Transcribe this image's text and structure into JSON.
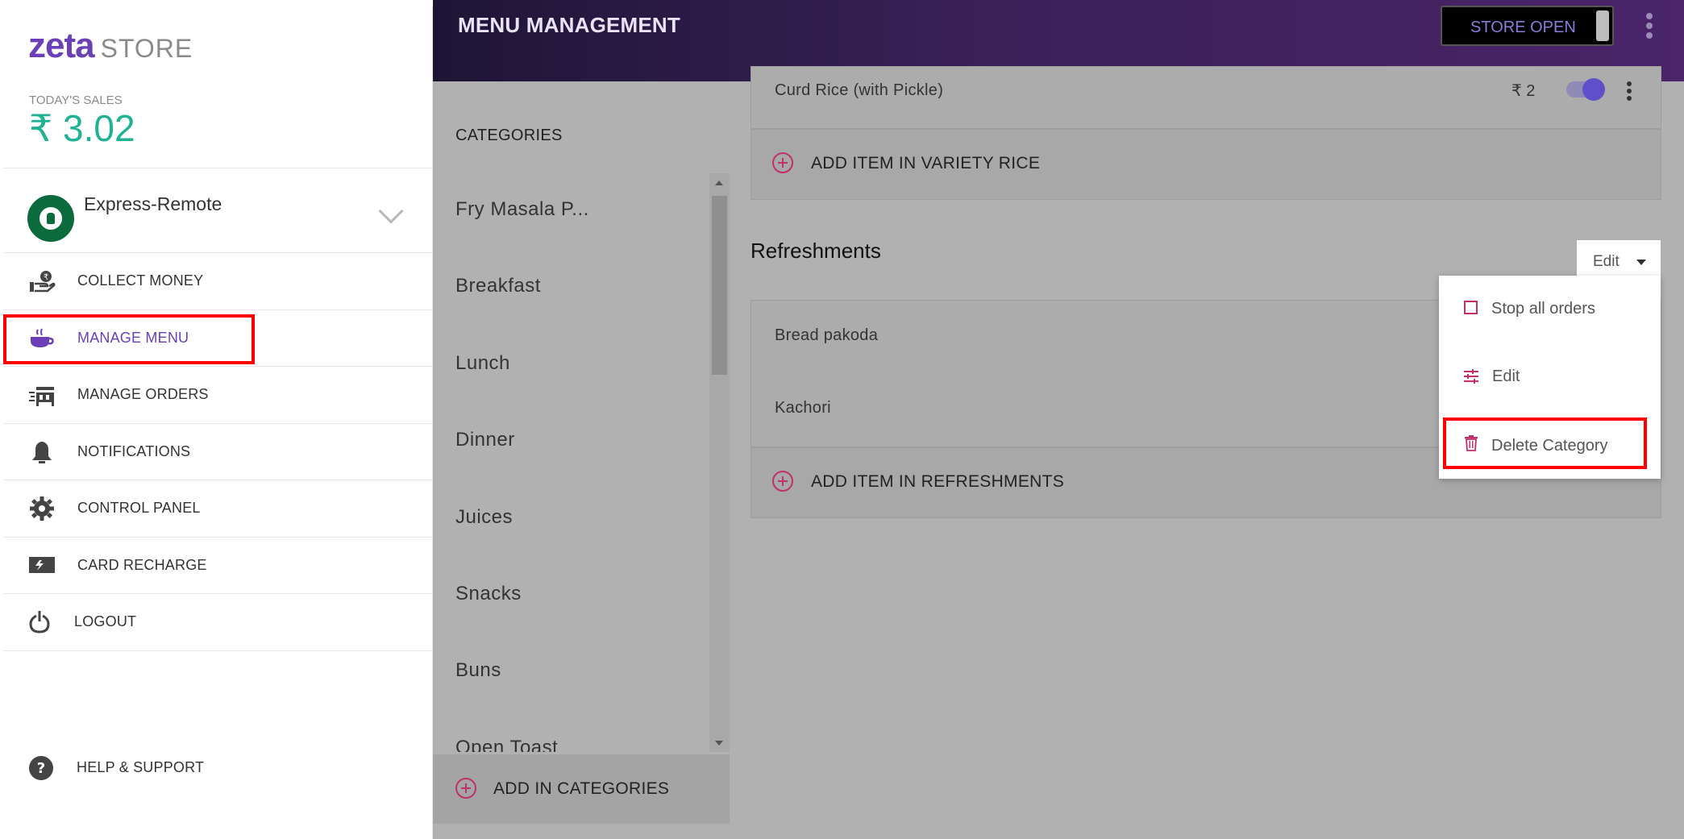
{
  "brand": {
    "logo": "zeta",
    "suffix": "STORE"
  },
  "sales": {
    "label": "TODAY'S SALES",
    "value": "₹ 3.02"
  },
  "store": {
    "name": "Express-Remote"
  },
  "nav": [
    {
      "label": "COLLECT MONEY",
      "icon": "hand-coin-icon"
    },
    {
      "label": "MANAGE MENU",
      "icon": "coffee-cup-icon",
      "active": true
    },
    {
      "label": "MANAGE ORDERS",
      "icon": "orders-icon"
    },
    {
      "label": "NOTIFICATIONS",
      "icon": "bell-icon"
    },
    {
      "label": "CONTROL PANEL",
      "icon": "gear-icon"
    },
    {
      "label": "CARD RECHARGE",
      "icon": "card-icon"
    },
    {
      "label": "LOGOUT",
      "icon": "power-icon"
    }
  ],
  "help": {
    "label": "HELP & SUPPORT",
    "icon": "question-icon"
  },
  "header": {
    "title": "MENU MANAGEMENT",
    "store_open_label": "STORE OPEN"
  },
  "categories": {
    "header": "CATEGORIES",
    "items": [
      "Fry Masala P...",
      "Breakfast",
      "Lunch",
      "Dinner",
      "Juices",
      "Snacks",
      "Buns",
      "Open Toast"
    ],
    "add_label": "ADD IN CATEGORIES"
  },
  "variety_rice": {
    "item": {
      "name": "Curd Rice (with Pickle)",
      "price": "₹ 2"
    },
    "add_label": "ADD ITEM IN VARIETY RICE"
  },
  "refreshments": {
    "title": "Refreshments",
    "edit_label": "Edit",
    "items": [
      "Bread pakoda",
      "Kachori"
    ],
    "add_label": "ADD ITEM IN REFRESHMENTS"
  },
  "dropdown": {
    "items": [
      {
        "label": "Stop all orders",
        "icon": "square-outline-icon"
      },
      {
        "label": "Edit",
        "icon": "sliders-icon"
      },
      {
        "label": "Delete Category",
        "icon": "trash-icon"
      }
    ]
  },
  "colors": {
    "accent_purple": "#6b3fb5",
    "sales_green": "#1fb394",
    "pink": "#c0306b",
    "highlight_red": "#ff0000"
  }
}
